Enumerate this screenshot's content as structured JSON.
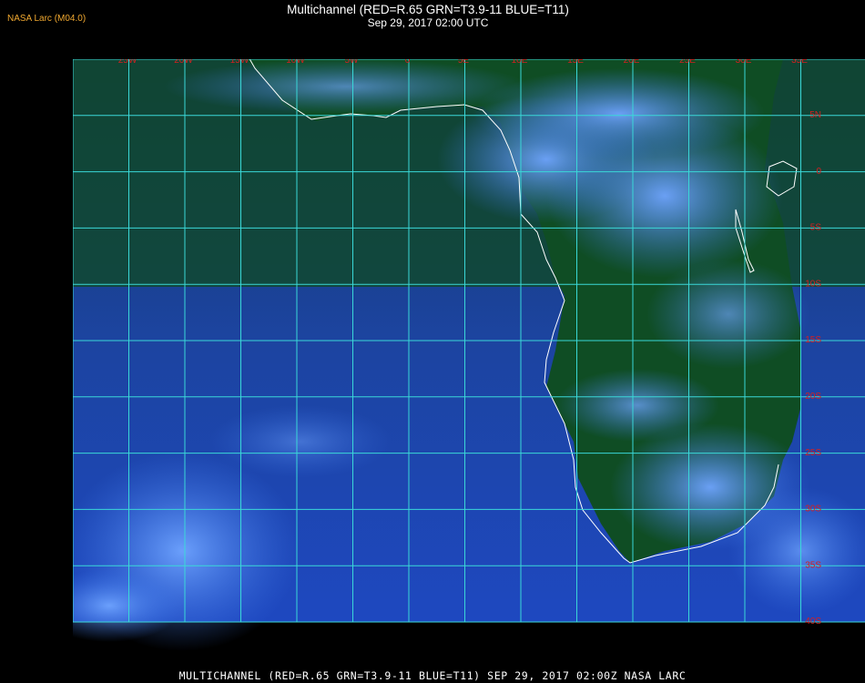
{
  "header": {
    "credit": "NASA Larc (M04.0)",
    "title": "Multichannel (RED=R.65 GRN=T3.9-11 BLUE=T11)",
    "subtitle": "Sep 29, 2017 02:00 UTC"
  },
  "footer": {
    "text": "MULTICHANNEL (RED=R.65 GRN=T3.9-11 BLUE=T11) SEP 29, 2017 02:00Z  NASA LARC"
  },
  "map": {
    "lon_labels": [
      "25W",
      "20W",
      "15W",
      "10W",
      "5W",
      "0",
      "5E",
      "10E",
      "15E",
      "20E",
      "25E",
      "30E",
      "35E"
    ],
    "lat_labels": [
      "5N",
      "0",
      "5S",
      "10S",
      "15S",
      "20S",
      "25S",
      "30S",
      "35S",
      "40S"
    ],
    "colors": {
      "grid": "#3ad8d8",
      "coast": "#ffffff",
      "label": "#d42020",
      "land": "#0f4a22",
      "ocean": "#1e46b0",
      "cloud": "#4e8ef0"
    }
  }
}
